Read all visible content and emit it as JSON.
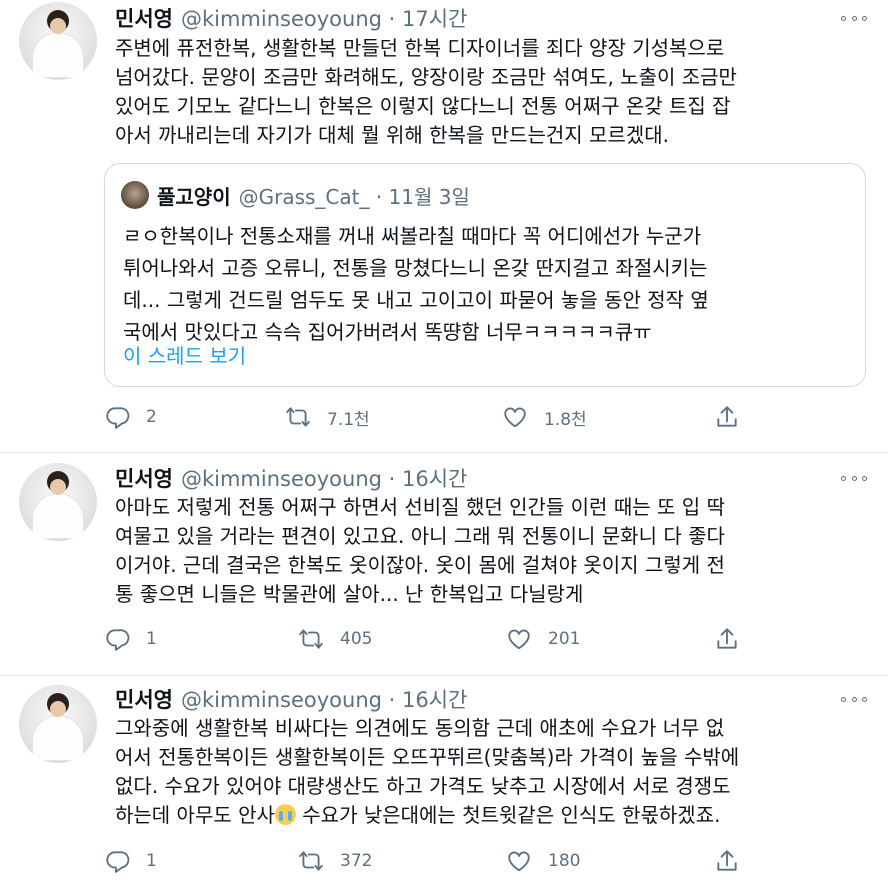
{
  "tweets": [
    {
      "name": "민서영",
      "meta": "@kimminseoyoung · 17시간",
      "lines": [
        "주변에 퓨전한복, 생활한복 만들던 한복 디자이너를 죄다 양장 기성복으로",
        "넘어갔다. 문양이 조금만 화려해도, 양장이랑 조금만 섞여도, 노출이 조금만",
        "있어도 기모노 같다느니 한복은 이렇지 않다느니 전통 어쩌구 온갖 트집 잡",
        "아서 까내리는데 자기가 대체 뭘 위해 한복을 만드는건지 모르겠대."
      ],
      "reply_count": "2",
      "retweet_count": "7.1천",
      "like_count": "1.8천"
    },
    {
      "name": "민서영",
      "meta": "@kimminseoyoung · 16시간",
      "lines": [
        "아마도 저렇게 전통 어쩌구 하면서 선비질 했던 인간들 이런 때는 또 입 딱",
        "여물고 있을 거라는 편견이 있고요. 아니 그래 뭐 전통이니 문화니 다 좋다",
        "이거야. 근데 결국은 한복도 옷이잖아. 옷이 몸에 걸쳐야 옷이지 그렇게 전",
        "통 좋으면 니들은 박물관에 살아... 난 한복입고 다닐랑게"
      ],
      "reply_count": "1",
      "retweet_count": "405",
      "like_count": "201"
    },
    {
      "name": "민서영",
      "meta": "@kimminseoyoung · 16시간",
      "lines": [
        "그와중에 생활한복 비싸다는 의견에도 동의함 근데 애초에 수요가 너무 없",
        "어서 전통한복이든 생활한복이든 오뜨꾸뛰르(맞춤복)라 가격이 높을 수밖에",
        "없다. 수요가 있어야 대량생산도 하고 가격도 낮추고 시장에서 서로 경쟁도"
      ],
      "line4_before": "하는데 아무도 안사",
      "line4_emoji": "loudly-crying-face-emoji",
      "line4_after": " 수요가 낮은대에는 첫트윗같은 인식도 한몫하겠죠.",
      "reply_count": "1",
      "retweet_count": "372",
      "like_count": "180"
    }
  ],
  "quote": {
    "name": "풀고양이",
    "meta": "@Grass_Cat_ · 11월 3일",
    "lines": [
      "ㄹㅇ한복이나 전통소재를 꺼내 써볼라칠 때마다 꼭 어디에선가 누군가",
      "튀어나와서 고증 오류니, 전통을 망쳤다느니 온갖 딴지걸고 좌절시키는",
      "데... 그렇게 건드릴 엄두도 못 내고 고이고이 파묻어 놓을 동안 정작 옆",
      "국에서 맛있다고 슥슥 집어가버려서 똑땽함 너무ㅋㅋㅋㅋㅋ큐ㅠ"
    ],
    "thread_link": "이 스레드 보기"
  },
  "icons": {
    "reply": "reply-icon",
    "retweet": "retweet-icon",
    "like": "heart-icon",
    "share": "share-icon",
    "more": "more-options-icon"
  },
  "colors": {
    "text": "#0f1419",
    "secondary": "#5b7083",
    "accent": "#1da1f2",
    "divider": "#e6ecf0"
  }
}
